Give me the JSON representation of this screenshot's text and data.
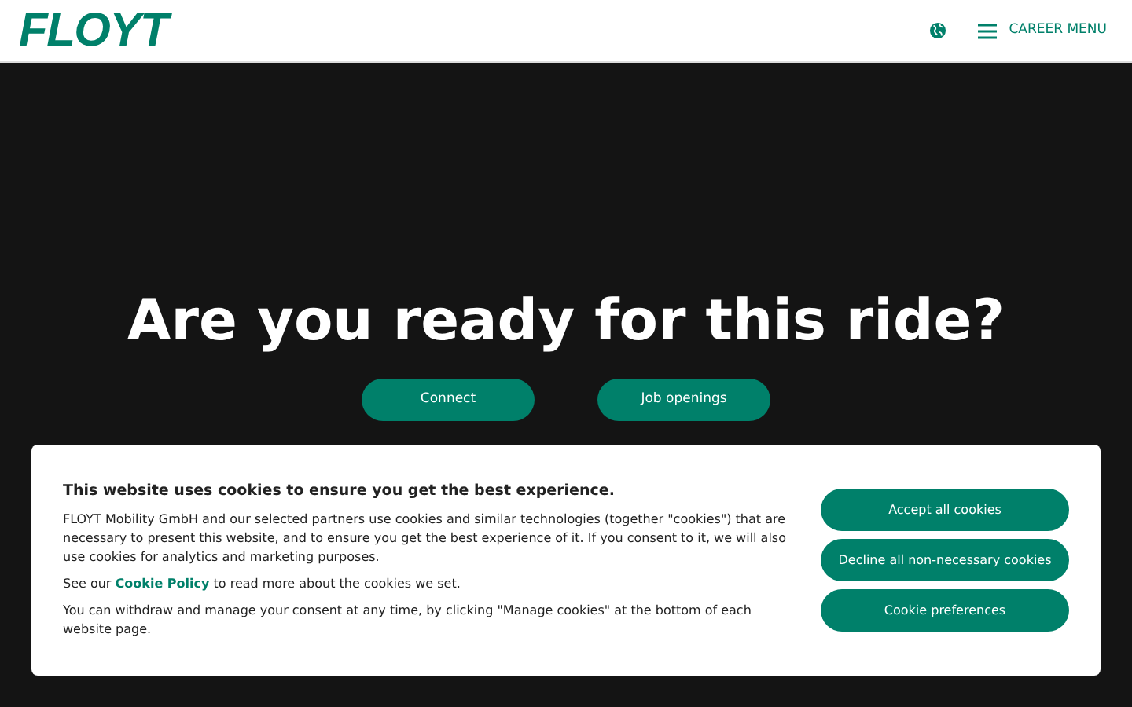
{
  "header": {
    "logo": "FLOYT",
    "menu_label": "CAREER MENU"
  },
  "hero": {
    "title": "Are you ready for this ride?",
    "buttons": [
      "Connect",
      "Job openings"
    ]
  },
  "cookie_banner": {
    "title": "This website uses cookies to ensure you get the best experience.",
    "paragraph": "FLOYT Mobility GmbH and our selected partners use cookies and similar technologies (together \"cookies\") that are necessary to present this website, and to ensure you get the best experience of it. If you consent to it, we will also use cookies for analytics and marketing purposes.",
    "policy_before": "See our",
    "policy_link": "Cookie Policy",
    "policy_after": "to read more about the cookies we set.",
    "withdraw": "You can withdraw and manage your consent at any time, by clicking \"Manage cookies\" at the bottom of each website page.",
    "buttons": [
      "Accept all cookies",
      "Decline all non-necessary cookies",
      "Cookie preferences"
    ]
  }
}
